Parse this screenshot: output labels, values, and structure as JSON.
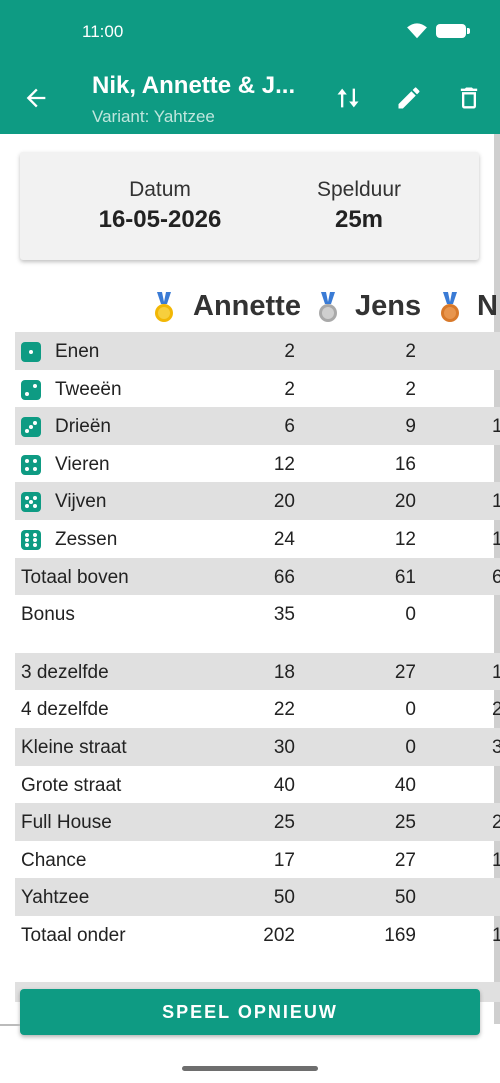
{
  "status_bar": {
    "time": "11:00"
  },
  "app_bar": {
    "title": "Nik, Annette & J...",
    "subtitle": "Variant: Yahtzee",
    "colors": {
      "primary": "#0e9b83"
    }
  },
  "summary": {
    "date_label": "Datum",
    "date_value": "16-05-2026",
    "duration_label": "Spelduur",
    "duration_value": "25m"
  },
  "players": [
    {
      "name": "Annette",
      "medal": "gold-medal-icon"
    },
    {
      "name": "Jens",
      "medal": "silver-medal-icon"
    },
    {
      "name": "N",
      "medal": "bronze-medal-icon"
    }
  ],
  "rows": [
    {
      "label": "Enen",
      "dice": 1,
      "values": [
        "2",
        "2",
        ""
      ]
    },
    {
      "label": "Tweeën",
      "dice": 2,
      "values": [
        "2",
        "2",
        ""
      ]
    },
    {
      "label": "Drieën",
      "dice": 3,
      "values": [
        "6",
        "9",
        "1"
      ]
    },
    {
      "label": "Vieren",
      "dice": 4,
      "values": [
        "12",
        "16",
        ""
      ]
    },
    {
      "label": "Vijven",
      "dice": 5,
      "values": [
        "20",
        "20",
        "1"
      ]
    },
    {
      "label": "Zessen",
      "dice": 6,
      "values": [
        "24",
        "12",
        "1"
      ]
    },
    {
      "label": "Totaal boven",
      "values": [
        "66",
        "61",
        "6"
      ]
    },
    {
      "label": "Bonus",
      "values": [
        "35",
        "0",
        ""
      ]
    },
    {
      "label": "3 dezelfde",
      "values": [
        "18",
        "27",
        "1"
      ]
    },
    {
      "label": "4 dezelfde",
      "values": [
        "22",
        "0",
        "2"
      ]
    },
    {
      "label": "Kleine straat",
      "values": [
        "30",
        "0",
        "3"
      ]
    },
    {
      "label": "Grote straat",
      "values": [
        "40",
        "40",
        ""
      ]
    },
    {
      "label": "Full House",
      "values": [
        "25",
        "25",
        "2"
      ]
    },
    {
      "label": "Chance",
      "values": [
        "17",
        "27",
        "1"
      ]
    },
    {
      "label": "Yahtzee",
      "values": [
        "50",
        "50",
        ""
      ]
    },
    {
      "label": "Totaal onder",
      "values": [
        "202",
        "169",
        "1("
      ]
    }
  ],
  "play_again_button": "SPEEL OPNIEUW"
}
